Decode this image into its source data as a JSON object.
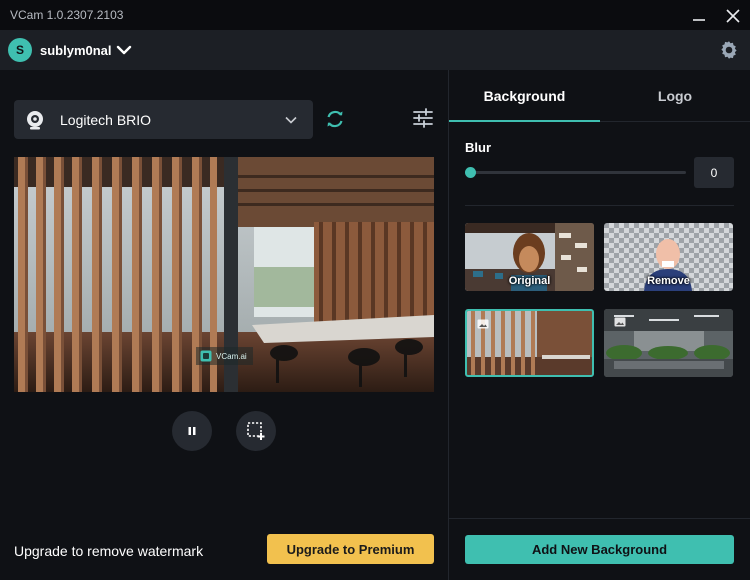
{
  "app": {
    "title": "VCam 1.0.2307.2103"
  },
  "user": {
    "initial": "S",
    "name": "sublym0nal"
  },
  "camera": {
    "selected": "Logitech BRIO"
  },
  "preview": {
    "watermark": "VCam.ai"
  },
  "upgrade": {
    "text": "Upgrade to remove watermark",
    "button_label": "Upgrade to Premium"
  },
  "tabs": [
    {
      "label": "Background",
      "active": true
    },
    {
      "label": "Logo",
      "active": false
    }
  ],
  "blur": {
    "label": "Blur",
    "value": "0",
    "level": 0
  },
  "backgrounds": [
    {
      "label": "Original"
    },
    {
      "label": "Remove"
    },
    {
      "label": "",
      "selected": true
    },
    {
      "label": ""
    }
  ],
  "actions": {
    "add_background": "Add New Background"
  },
  "colors": {
    "accent": "#3fbfb0",
    "premium": "#f2c14e",
    "panel": "#1c1f25",
    "background": "#0f1115"
  },
  "icons": [
    "close-icon",
    "minimize-icon",
    "chevron-down-icon",
    "gear-icon",
    "webcam-icon",
    "refresh-icon",
    "sliders-icon",
    "pause-icon",
    "crop-select-icon",
    "image-icon"
  ]
}
